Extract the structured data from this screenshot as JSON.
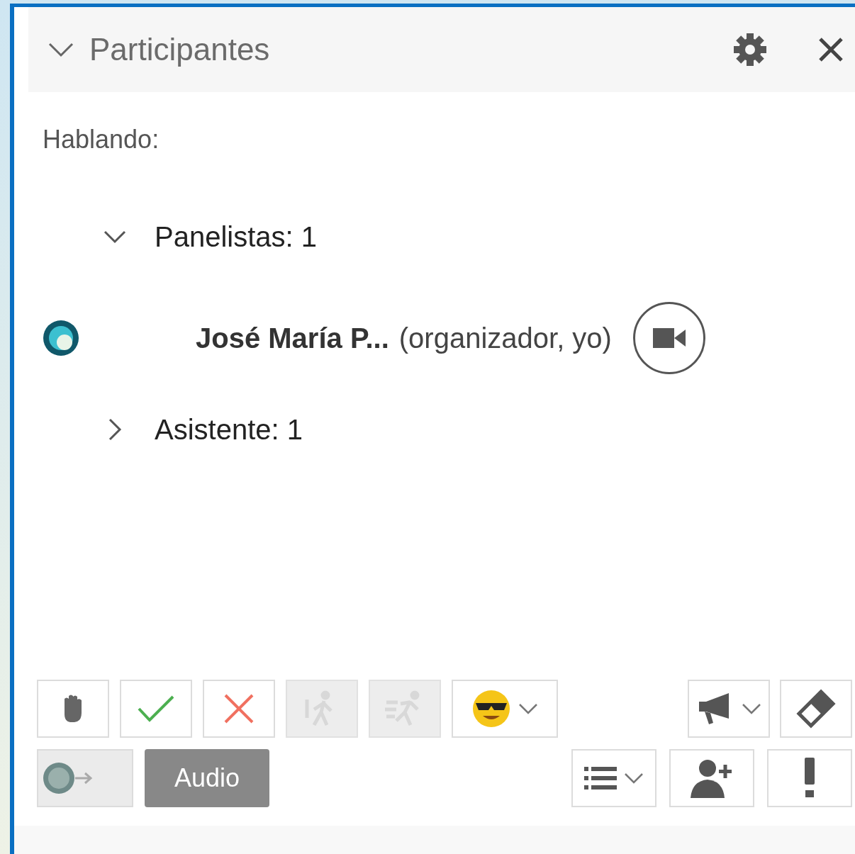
{
  "panel": {
    "title": "Participantes",
    "expanded": true
  },
  "speaking_label": "Hablando:",
  "groups": [
    {
      "label": "Panelistas: 1",
      "expanded": true,
      "participants": [
        {
          "name": "José María P...",
          "role": "(organizador, yo)"
        }
      ]
    },
    {
      "label": "Asistente: 1",
      "expanded": false
    }
  ],
  "toolbar_top": [
    {
      "kind": "hand",
      "disabled": false
    },
    {
      "kind": "check",
      "disabled": false
    },
    {
      "kind": "cross",
      "disabled": false
    },
    {
      "kind": "walk",
      "disabled": true
    },
    {
      "kind": "run",
      "disabled": true
    },
    {
      "kind": "emoji",
      "disabled": false
    }
  ],
  "toolbar_top_right": [
    {
      "kind": "megaphone"
    },
    {
      "kind": "eraser"
    }
  ],
  "audio_button": "Audio",
  "toolbar_bottom_right": [
    {
      "kind": "list"
    },
    {
      "kind": "add-person"
    },
    {
      "kind": "alert"
    }
  ]
}
